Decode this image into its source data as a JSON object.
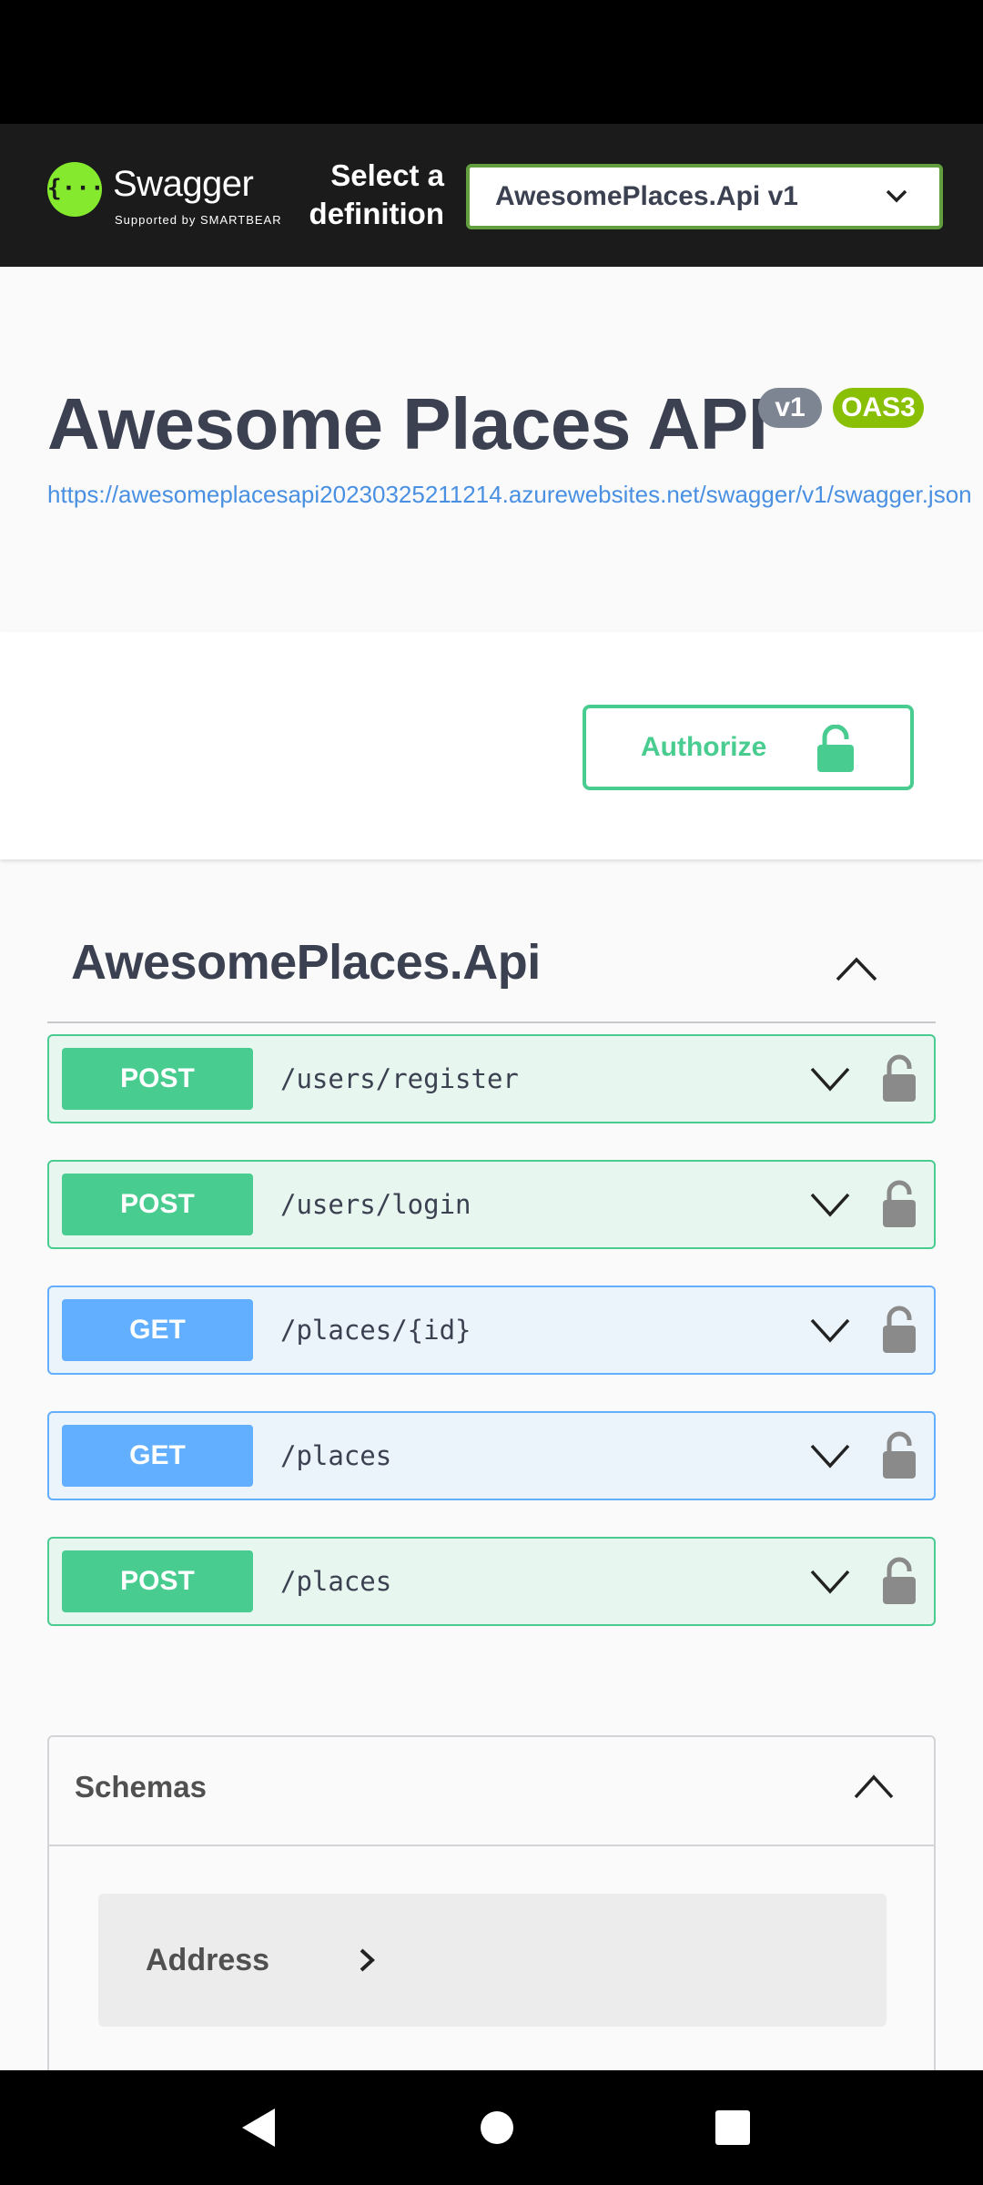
{
  "header": {
    "logo_text": "Swagger",
    "logo_sub": "Supported by SMARTBEAR",
    "select_label": "Select a definition",
    "selected_definition": "AwesomePlaces.Api v1"
  },
  "info": {
    "title": "Awesome Places API",
    "version_badge": "v1",
    "oas_badge": "OAS3",
    "url": "https://awesomeplacesapi20230325211214.azurewebsites.net/swagger/v1/swagger.json"
  },
  "auth": {
    "label": "Authorize"
  },
  "tag": {
    "name": "AwesomePlaces.Api"
  },
  "operations": [
    {
      "method": "POST",
      "path": "/users/register"
    },
    {
      "method": "POST",
      "path": "/users/login"
    },
    {
      "method": "GET",
      "path": "/places/{id}"
    },
    {
      "method": "GET",
      "path": "/places"
    },
    {
      "method": "POST",
      "path": "/places"
    }
  ],
  "schemas": {
    "title": "Schemas",
    "models": [
      {
        "name": "Address"
      }
    ]
  },
  "colors": {
    "post": "#49cc90",
    "get": "#61affe",
    "swagger_green": "#85ea2d",
    "topbar": "#1b1b1b"
  },
  "icons": [
    "swagger-logo-icon",
    "chevron-down-icon",
    "chevron-up-icon",
    "lock-icon",
    "chevron-right-icon",
    "nav-back-icon",
    "nav-home-icon",
    "nav-recents-icon"
  ]
}
